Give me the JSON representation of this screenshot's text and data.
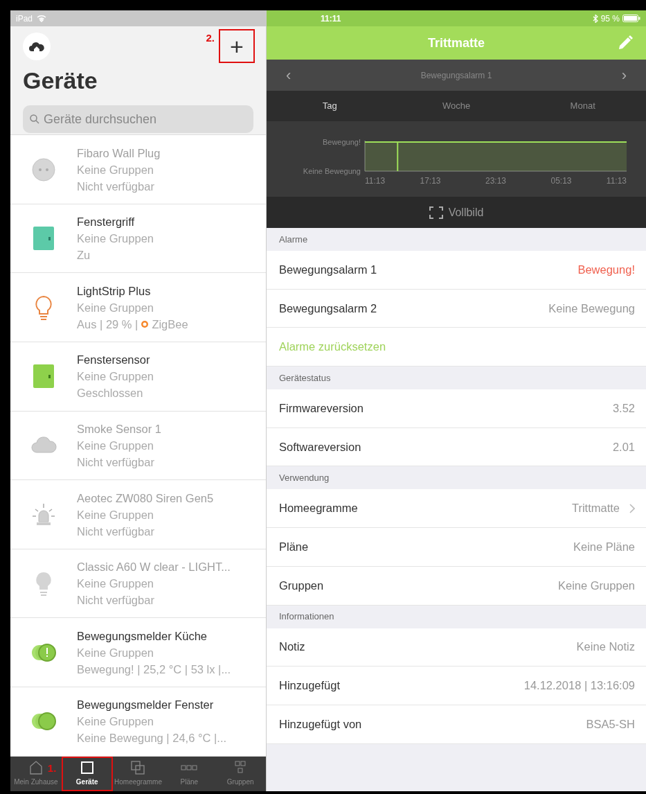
{
  "status_bar": {
    "device": "iPad",
    "time": "11:11",
    "battery": "95 %"
  },
  "sidebar": {
    "title": "Geräte",
    "add_button": {
      "label": "+",
      "annotation": "2."
    },
    "search": {
      "placeholder": "Geräte durchsuchen"
    },
    "devices": [
      {
        "kind": "plug",
        "name": "Fibaro Wall Plug",
        "groups": "Keine Gruppen",
        "status": "Nicht verfügbar",
        "available": false
      },
      {
        "kind": "handle",
        "name": "Fenstergriff",
        "groups": "Keine Gruppen",
        "status": "Zu",
        "available": true
      },
      {
        "kind": "bulb",
        "name": "LightStrip Plus",
        "groups": "Keine Gruppen",
        "status": "Aus | 29 % |",
        "status_tag": "ZigBee",
        "available": true
      },
      {
        "kind": "contact",
        "name": "Fenstersensor",
        "groups": "Keine Gruppen",
        "status": "Geschlossen",
        "available": true
      },
      {
        "kind": "cloud",
        "name": "Smoke Sensor 1",
        "groups": "Keine Gruppen",
        "status": "Nicht verfügbar",
        "available": false
      },
      {
        "kind": "siren",
        "name": "Aeotec ZW080 Siren Gen5",
        "groups": "Keine Gruppen",
        "status": "Nicht verfügbar",
        "available": false
      },
      {
        "kind": "bulb-off",
        "name": "Classic A60 W clear - LIGHT...",
        "groups": "Keine Gruppen",
        "status": "Nicht verfügbar",
        "available": false
      },
      {
        "kind": "motion-alert",
        "name": "Bewegungsmelder Küche",
        "groups": "Keine Gruppen",
        "status": "Bewegung! | 25,2 °C | 53 lx |...",
        "available": true
      },
      {
        "kind": "motion",
        "name": "Bewegungsmelder Fenster",
        "groups": "Keine Gruppen",
        "status": "Keine Bewegung | 24,6 °C |...",
        "available": true
      }
    ]
  },
  "tab_bar": [
    {
      "kind": "home",
      "label": "Mein Zuhause",
      "selected": false
    },
    {
      "kind": "device",
      "label": "Geräte",
      "selected": true,
      "annotation": "1."
    },
    {
      "kind": "homeegram",
      "label": "Homeegramme",
      "selected": false
    },
    {
      "kind": "plan",
      "label": "Pläne",
      "selected": false
    },
    {
      "kind": "group",
      "label": "Gruppen",
      "selected": false
    }
  ],
  "detail": {
    "title": "Trittmatte",
    "pager": {
      "label": "Bewegungsalarm 1",
      "prev": "‹",
      "next": "›"
    },
    "periods": [
      {
        "label": "Tag",
        "selected": true
      },
      {
        "label": "Woche",
        "selected": false
      },
      {
        "label": "Monat",
        "selected": false
      }
    ],
    "chart": {
      "x_labels": [
        "11:13",
        "17:13",
        "23:13",
        "05:13",
        "11:13"
      ],
      "y_labels": [
        "Bewegung!",
        "Keine Bewegung"
      ]
    },
    "fullscreen": "Vollbild",
    "sections": [
      {
        "title": "Alarme",
        "rows": [
          {
            "kind": "value",
            "label": "Bewegungsalarm 1",
            "value": "Bewegung!",
            "alert": true
          },
          {
            "kind": "value",
            "label": "Bewegungsalarm 2",
            "value": "Keine Bewegung",
            "alert": false
          },
          {
            "kind": "action",
            "label": "Alarme zurücksetzen"
          }
        ]
      },
      {
        "title": "Gerätestatus",
        "rows": [
          {
            "kind": "value",
            "label": "Firmwareversion",
            "value": "3.52",
            "alert": false
          },
          {
            "kind": "value",
            "label": "Softwareversion",
            "value": "2.01",
            "alert": false
          }
        ]
      },
      {
        "title": "Verwendung",
        "rows": [
          {
            "kind": "link",
            "label": "Homeegramme",
            "value": "Trittmatte",
            "alert": false
          },
          {
            "kind": "value",
            "label": "Pläne",
            "value": "Keine Pläne",
            "alert": false
          },
          {
            "kind": "value",
            "label": "Gruppen",
            "value": "Keine Gruppen",
            "alert": false
          }
        ]
      },
      {
        "title": "Informationen",
        "rows": [
          {
            "kind": "value",
            "label": "Notiz",
            "value": "Keine Notiz",
            "alert": false
          },
          {
            "kind": "value",
            "label": "Hinzugefügt",
            "value": "14.12.2018 | 13:16:09",
            "alert": false
          },
          {
            "kind": "value",
            "label": "Hinzugefügt von",
            "value": "BSA5-SH",
            "alert": false
          }
        ]
      }
    ]
  }
}
